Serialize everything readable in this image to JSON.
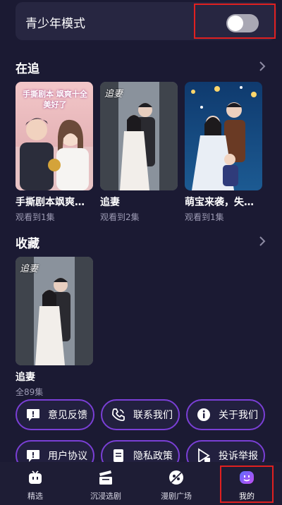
{
  "teen_mode": {
    "label": "青少年模式",
    "enabled": false
  },
  "following": {
    "title": "在追",
    "items": [
      {
        "title": "手撕剧本飒爽…",
        "progress": "观看到1集",
        "poster_text": "手撕剧本 飒爽十全美好了"
      },
      {
        "title": "追妻",
        "progress": "观看到2集",
        "poster_text": "追妻"
      },
      {
        "title": "萌宝来袭，失…",
        "progress": "观看到1集",
        "poster_text": ""
      }
    ]
  },
  "favorites": {
    "title": "收藏",
    "items": [
      {
        "title": "追妻",
        "episodes": "全89集",
        "poster_text": "追妻"
      }
    ]
  },
  "actions": [
    {
      "label": "意见反馈",
      "icon": "feedback-icon"
    },
    {
      "label": "联系我们",
      "icon": "phone-icon"
    },
    {
      "label": "关于我们",
      "icon": "info-icon"
    },
    {
      "label": "用户协议",
      "icon": "agreement-icon"
    },
    {
      "label": "隐私政策",
      "icon": "privacy-icon"
    },
    {
      "label": "投诉举报",
      "icon": "report-icon"
    }
  ],
  "tabs": [
    {
      "label": "精选",
      "icon": "tv-icon"
    },
    {
      "label": "沉浸选剧",
      "icon": "clapper-icon"
    },
    {
      "label": "漫剧广场",
      "icon": "comic-icon"
    },
    {
      "label": "我的",
      "icon": "profile-icon",
      "active": true
    }
  ],
  "colors": {
    "background": "#1b1a33",
    "accent": "#7a3fd6",
    "highlight_box": "#e02020"
  }
}
